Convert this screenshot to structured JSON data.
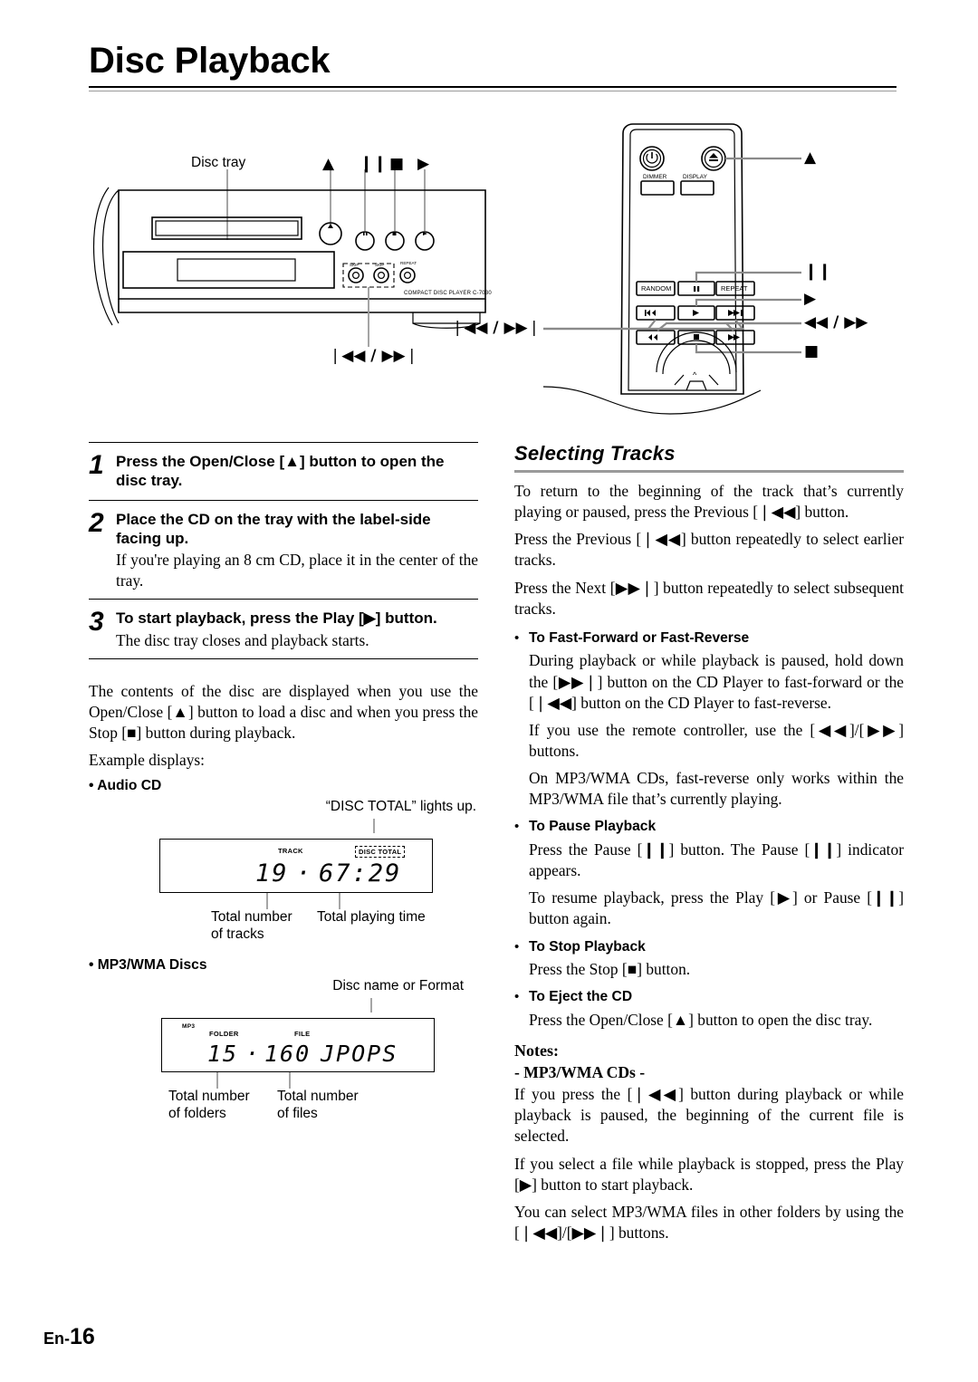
{
  "page": {
    "title": "Disc Playback",
    "footer_prefix": "En-",
    "footer_number": "16"
  },
  "diagram": {
    "disc_tray_label": "Disc tray",
    "player_model_text": "COMPACT DISC PLAYER  C-7030",
    "player_skip_label": "❘◀◀ / ▶▶❘",
    "player_top_symbols": [
      "▲",
      "❙❙",
      "■",
      "▶"
    ],
    "player_front_button_tags": [
      "SKIP",
      "SKIP",
      "REPEAT"
    ],
    "remote": {
      "power_icon": "power-icon",
      "eject_icon": "eject-icon",
      "dimmer_label": "DIMMER",
      "display_label": "DISPLAY",
      "random_label": "RANDOM",
      "repeat_label": "REPEAT",
      "pause_label": "❙❙",
      "play_label": "▶",
      "prev_label": "❘◀◀",
      "next_label": "▶▶❘",
      "frev_label": "◀◀",
      "ffwd_label": "▶▶",
      "stop_label": "■",
      "nav_up_label": "∧"
    },
    "callouts": {
      "eject": "▲",
      "pause": "❙❙",
      "play": "▶",
      "stop": "■",
      "skip": "❘◀◀ / ▶▶❘",
      "fast": "◀◀ / ▶▶"
    }
  },
  "steps": [
    {
      "number": "1",
      "heading": "Press the Open/Close [▲] button to open the disc tray.",
      "body": ""
    },
    {
      "number": "2",
      "heading": "Place the CD on the tray with the label-side facing up.",
      "body": "If you're playing an 8 cm CD, place it in the center of the tray."
    },
    {
      "number": "3",
      "heading": "To start playback, press the Play [▶] button.",
      "body": "The disc tray closes and playback starts."
    }
  ],
  "left_body": {
    "intro": "The contents of the disc are displayed when you use the Open/Close [▲] button to load a disc and when you press the Stop [■] button during playback.",
    "example_label": "Example displays:",
    "audio_cd": {
      "bullet": "• Audio CD",
      "top_caption": "“DISC TOTAL” lights up.",
      "tag_track": "TRACK",
      "tag_disc_total": "DISC TOTAL",
      "value_track": "19",
      "value_separator": "·",
      "value_time": "67:29",
      "caption_left_line1": "Total number",
      "caption_left_line2": "of tracks",
      "caption_right_line1": "Total playing time",
      "caption_right_line2": ""
    },
    "mp3_wma": {
      "bullet": "• MP3/WMA Discs",
      "top_caption": "Disc name or Format",
      "tag_mp3": "MP3",
      "tag_folder": "FOLDER",
      "tag_file": "FILE",
      "value_folder": "15",
      "value_separator": "·",
      "value_file": "160",
      "value_name": "JPOPS",
      "caption_left_line1": "Total number",
      "caption_left_line2": "of folders",
      "caption_right_line1": "Total number",
      "caption_right_line2": "of files"
    }
  },
  "right_body": {
    "section_heading": "Selecting Tracks",
    "paragraphs": [
      "To return to the beginning of the track that’s currently playing or paused, press the Previous [❘◀◀] button.",
      "Press the Previous [❘◀◀] button repeatedly to select earlier tracks.",
      "Press the Next [▶▶❘] button repeatedly to select subsequent tracks."
    ],
    "bullets": [
      {
        "heading": "To Fast-Forward or Fast-Reverse",
        "paragraphs": [
          "During playback or while playback is paused, hold down the [▶▶❘] button on the CD Player to fast-forward or the [❘◀◀] button on the CD Player to fast-reverse.",
          "If you use the remote controller, use the [◀◀]/[▶▶] buttons.",
          "On MP3/WMA CDs, fast-reverse only works within the MP3/WMA file that’s currently playing."
        ]
      },
      {
        "heading": "To Pause Playback",
        "paragraphs": [
          "Press the Pause [❙❙] button. The Pause [❙❙] indicator appears.",
          "To resume playback, press the Play [▶] or Pause [❙❙] button again."
        ]
      },
      {
        "heading": "To Stop Playback",
        "paragraphs": [
          "Press the Stop [■] button."
        ]
      },
      {
        "heading": "To Eject the CD",
        "paragraphs": [
          "Press the Open/Close [▲] button to open the disc tray."
        ]
      }
    ],
    "notes_heading": "Notes:",
    "notes_subheading": "- MP3/WMA CDs -",
    "notes_paragraphs": [
      "If you press the [❘◀◀] button during playback or while playback is paused, the beginning of the current file is selected.",
      "If you select a file while playback is stopped, press the Play [▶] button to start playback.",
      "You can select MP3/WMA files in other folders by using the [❘◀◀]/[▶▶❘] buttons."
    ]
  }
}
